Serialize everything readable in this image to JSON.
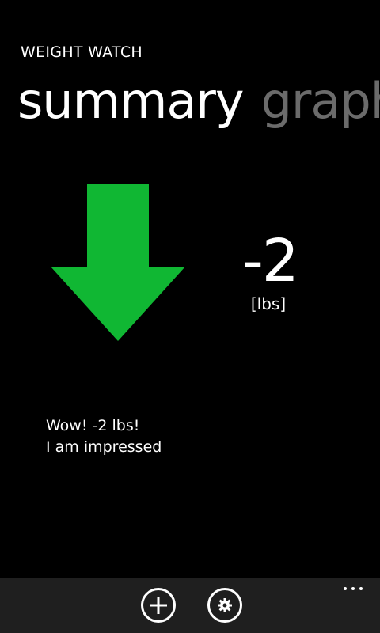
{
  "app": {
    "title": "WEIGHT WATCH"
  },
  "pivot": {
    "tabs": [
      {
        "label": "summary",
        "active": true
      },
      {
        "label": "graph",
        "active": false
      }
    ]
  },
  "summary": {
    "trend_icon": "down-arrow-icon",
    "trend_color": "#10b733",
    "delta": "-2",
    "unit": "[lbs]",
    "message_line1": "Wow! -2 lbs!",
    "message_line2": "I am impressed"
  },
  "app_bar": {
    "buttons": [
      {
        "icon": "plus-icon"
      },
      {
        "icon": "gear-icon"
      }
    ],
    "more_icon": "ellipsis-icon",
    "background": "#1f1f1f"
  },
  "colors": {
    "background": "#000000",
    "text": "#ffffff",
    "inactive_tab": "#6b6b6b"
  }
}
